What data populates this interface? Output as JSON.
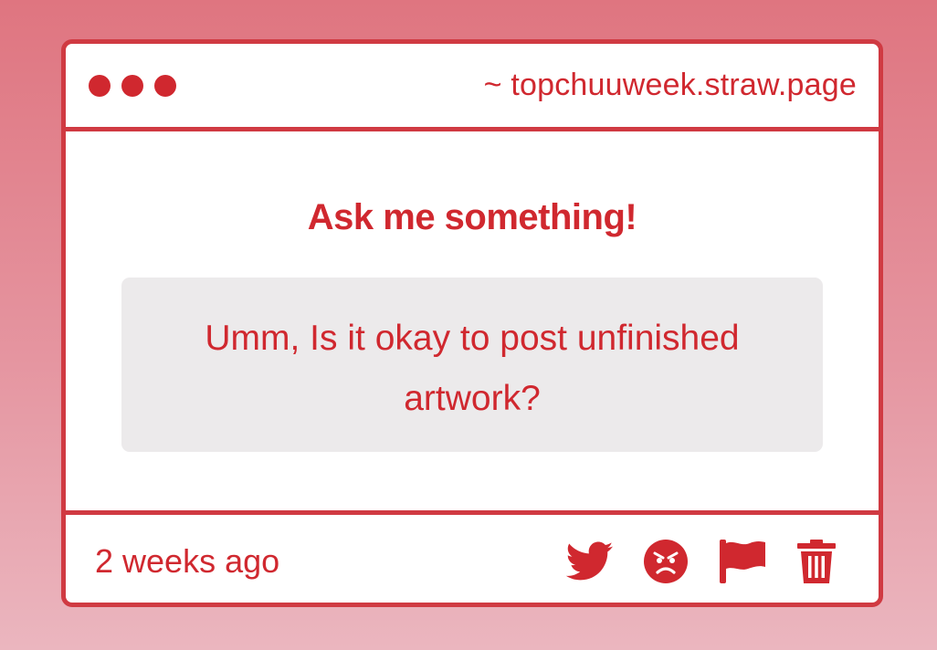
{
  "window": {
    "url": "~ topchuuweek.straw.page",
    "dots": [
      "red-dot",
      "red-dot",
      "red-dot"
    ]
  },
  "content": {
    "heading": "Ask me something!",
    "question": "Umm, Is it okay to post unfinished artwork?"
  },
  "footer": {
    "timestamp": "2 weeks ago",
    "actions": [
      "twitter-icon",
      "angry-face-icon",
      "flag-icon",
      "trash-icon"
    ]
  },
  "colors": {
    "accent": "#d0282f",
    "border": "#d03a42",
    "question_bg": "#eceaeb",
    "background_top": "#df7580",
    "background_bottom": "#ebb6bf"
  }
}
